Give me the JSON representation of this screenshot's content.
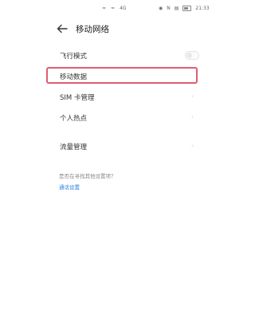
{
  "status_bar": {
    "left_icons": [
      "signal-icon",
      "wifi-icon",
      "data-icon"
    ],
    "left_texts": [
      "≈",
      "≈",
      "4G"
    ],
    "right_icons": [
      "eye-icon",
      "nfc-icon",
      "vibrate-icon",
      "battery-icon"
    ],
    "time": "21:33"
  },
  "header": {
    "title": "移动网络"
  },
  "items": [
    {
      "label": "飞行模式",
      "control": "toggle"
    },
    {
      "label": "移动数据",
      "control": "none"
    },
    {
      "label": "SIM 卡管理",
      "control": "chevron"
    },
    {
      "label": "个人热点",
      "control": "chevron"
    },
    {
      "label": "流量管理",
      "control": "chevron"
    }
  ],
  "footer": {
    "hint": "是否在寻找其他设置项？",
    "link": "通话设置"
  },
  "colors": {
    "highlight": "#e25c72",
    "link": "#2a7de1"
  }
}
